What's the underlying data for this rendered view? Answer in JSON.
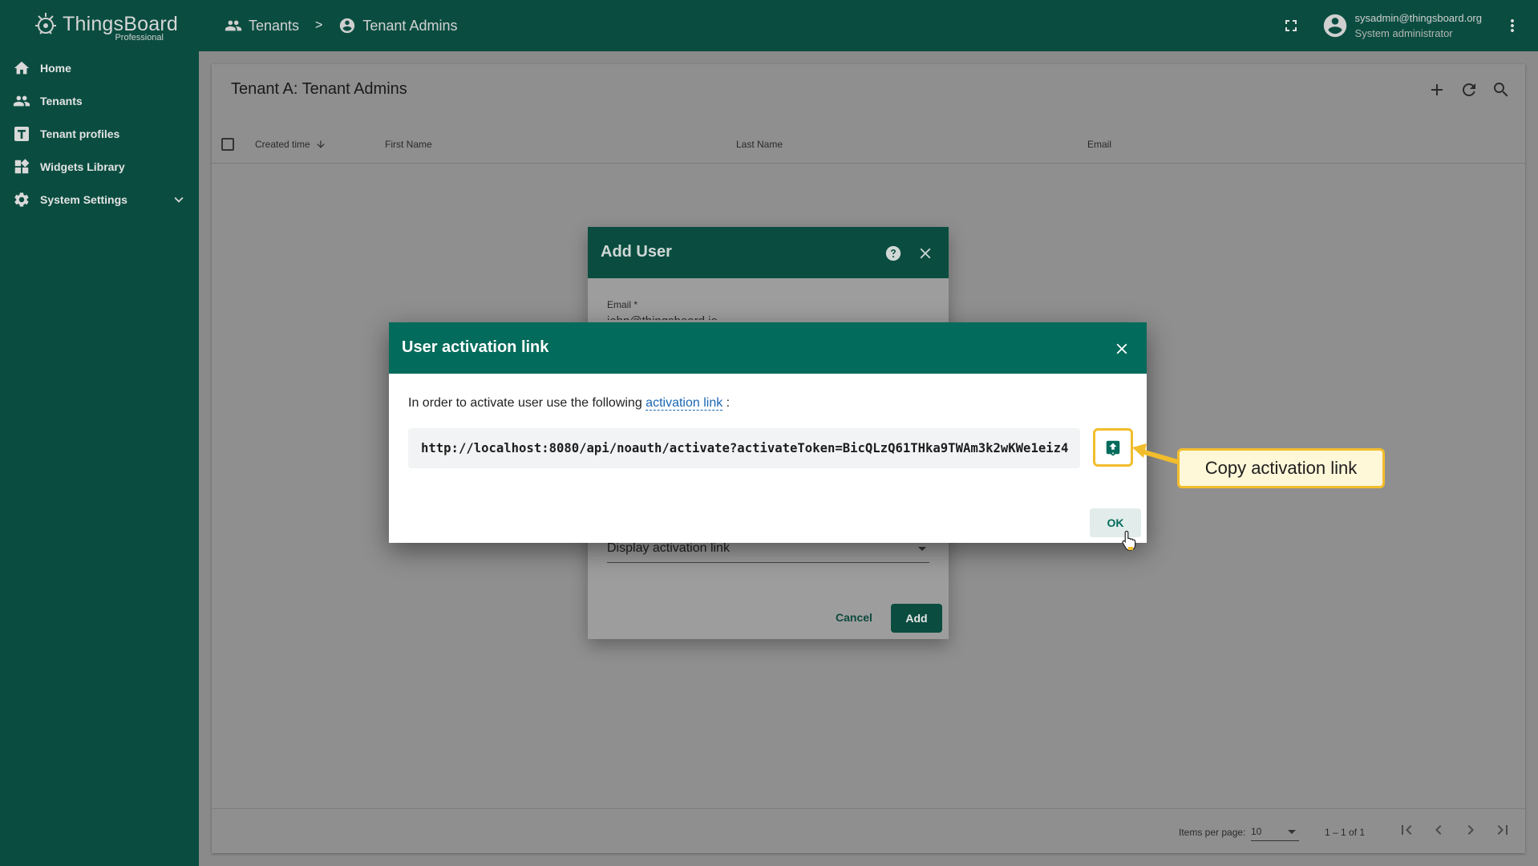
{
  "header": {
    "brand": "ThingsBoard",
    "brand_sub": "Professional",
    "breadcrumb": [
      {
        "label": "Tenants",
        "icon": "people-icon"
      },
      {
        "label": "Tenant Admins",
        "icon": "account-circle-icon"
      }
    ],
    "breadcrumb_separator": ">",
    "user_email": "sysadmin@thingsboard.org",
    "user_role": "System administrator"
  },
  "sidebar": {
    "items": [
      {
        "label": "Home",
        "icon": "home-icon"
      },
      {
        "label": "Tenants",
        "icon": "people-icon"
      },
      {
        "label": "Tenant profiles",
        "icon": "tenant-profile-icon"
      },
      {
        "label": "Widgets Library",
        "icon": "widgets-icon"
      },
      {
        "label": "System Settings",
        "icon": "gear-icon"
      }
    ]
  },
  "table": {
    "title": "Tenant A: Tenant Admins",
    "columns": [
      "Created time",
      "First Name",
      "Last Name",
      "Email"
    ],
    "items_per_page_label": "Items per page:",
    "items_per_page": "10",
    "range": "1 – 1 of 1"
  },
  "add_user_dialog": {
    "title": "Add User",
    "email_label": "Email *",
    "email_value": "john@thingsboard.io",
    "activation_method": "Display activation link",
    "cancel_label": "Cancel",
    "add_label": "Add"
  },
  "activation_dialog": {
    "title": "User activation link",
    "text_before": "In order to activate user use the following",
    "link_text": "activation link",
    "text_after": ":",
    "url": "http://localhost:8080/api/noauth/activate?activateToken=BicQLzQ61THka9TWAm3k2wKWe1eiz4",
    "ok_label": "OK"
  },
  "callout": {
    "text": "Copy activation link"
  },
  "colors": {
    "primary": "#036b5b",
    "primary_dark": "#0a4d40",
    "highlight": "#f2bd2b",
    "link": "#1967b3"
  }
}
